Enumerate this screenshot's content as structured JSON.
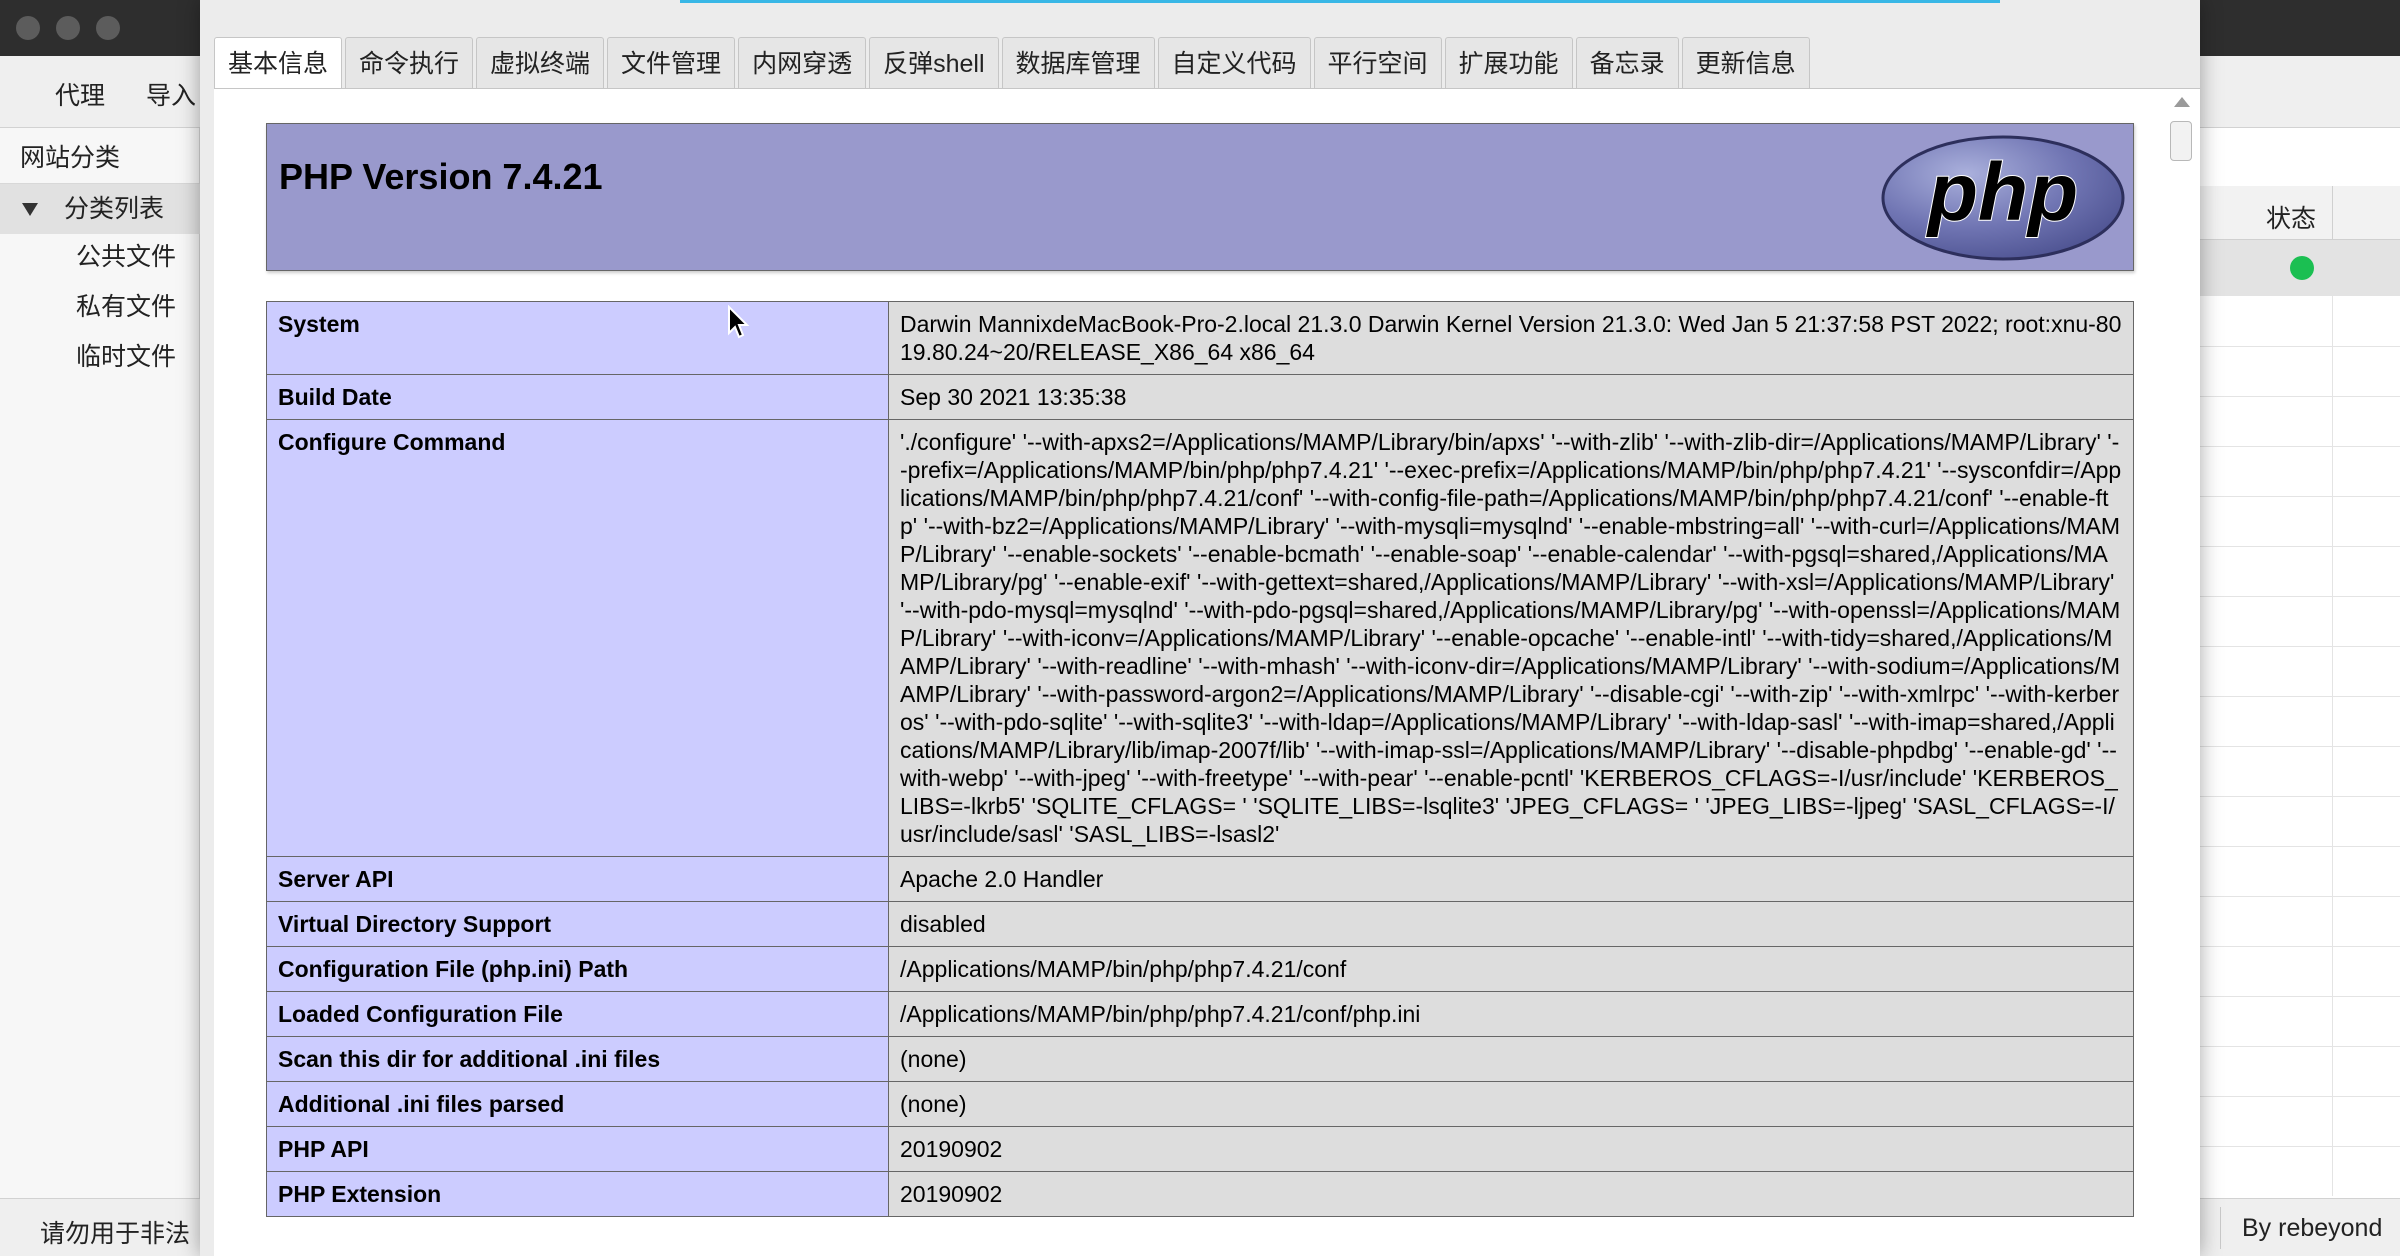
{
  "main_window": {
    "toolbar": {
      "proxy_label": "代理",
      "import_label": "导入"
    },
    "sidebar": {
      "header": "网站分类",
      "tree_root": "分类列表",
      "children": [
        "公共文件",
        "私有文件",
        "临时文件"
      ]
    },
    "table": {
      "status_column": "状态"
    },
    "statusbar": {
      "left_text": "请勿用于非法",
      "right_text": "By rebeyond"
    },
    "colors": {
      "status_online": "#1bbf52"
    }
  },
  "dialog": {
    "tabs": [
      "基本信息",
      "命令执行",
      "虚拟终端",
      "文件管理",
      "内网穿透",
      "反弹shell",
      "数据库管理",
      "自定义代码",
      "平行空间",
      "扩展功能",
      "备忘录",
      "更新信息"
    ],
    "active_tab_index": 0,
    "phpinfo": {
      "title": "PHP Version 7.4.21",
      "logo_text": "php",
      "rows": [
        {
          "key": "System",
          "value": "Darwin MannixdeMacBook-Pro-2.local 21.3.0 Darwin Kernel Version 21.3.0: Wed Jan 5 21:37:58 PST 2022; root:xnu-8019.80.24~20/RELEASE_X86_64 x86_64"
        },
        {
          "key": "Build Date",
          "value": "Sep 30 2021 13:35:38"
        },
        {
          "key": "Configure Command",
          "value": "'./configure' '--with-apxs2=/Applications/MAMP/Library/bin/apxs' '--with-zlib' '--with-zlib-dir=/Applications/MAMP/Library' '--prefix=/Applications/MAMP/bin/php/php7.4.21' '--exec-prefix=/Applications/MAMP/bin/php/php7.4.21' '--sysconfdir=/Applications/MAMP/bin/php/php7.4.21/conf' '--with-config-file-path=/Applications/MAMP/bin/php/php7.4.21/conf' '--enable-ftp' '--with-bz2=/Applications/MAMP/Library' '--with-mysqli=mysqlnd' '--enable-mbstring=all' '--with-curl=/Applications/MAMP/Library' '--enable-sockets' '--enable-bcmath' '--enable-soap' '--enable-calendar' '--with-pgsql=shared,/Applications/MAMP/Library/pg' '--enable-exif' '--with-gettext=shared,/Applications/MAMP/Library' '--with-xsl=/Applications/MAMP/Library' '--with-pdo-mysql=mysqlnd' '--with-pdo-pgsql=shared,/Applications/MAMP/Library/pg' '--with-openssl=/Applications/MAMP/Library' '--with-iconv=/Applications/MAMP/Library' '--enable-opcache' '--enable-intl' '--with-tidy=shared,/Applications/MAMP/Library' '--with-readline' '--with-mhash' '--with-iconv-dir=/Applications/MAMP/Library' '--with-sodium=/Applications/MAMP/Library' '--with-password-argon2=/Applications/MAMP/Library' '--disable-cgi' '--with-zip' '--with-xmlrpc' '--with-kerberos' '--with-pdo-sqlite' '--with-sqlite3' '--with-ldap=/Applications/MAMP/Library' '--with-ldap-sasl' '--with-imap=shared,/Applications/MAMP/Library/lib/imap-2007f/lib' '--with-imap-ssl=/Applications/MAMP/Library' '--disable-phpdbg' '--enable-gd' '--with-webp' '--with-jpeg' '--with-freetype' '--with-pear' '--enable-pcntl' 'KERBEROS_CFLAGS=-I/usr/include' 'KERBEROS_LIBS=-lkrb5' 'SQLITE_CFLAGS= ' 'SQLITE_LIBS=-lsqlite3' 'JPEG_CFLAGS= ' 'JPEG_LIBS=-ljpeg' 'SASL_CFLAGS=-I/usr/include/sasl' 'SASL_LIBS=-lsasl2'"
        },
        {
          "key": "Server API",
          "value": "Apache 2.0 Handler"
        },
        {
          "key": "Virtual Directory Support",
          "value": "disabled"
        },
        {
          "key": "Configuration File (php.ini) Path",
          "value": "/Applications/MAMP/bin/php/php7.4.21/conf"
        },
        {
          "key": "Loaded Configuration File",
          "value": "/Applications/MAMP/bin/php/php7.4.21/conf/php.ini"
        },
        {
          "key": "Scan this dir for additional .ini files",
          "value": "(none)"
        },
        {
          "key": "Additional .ini files parsed",
          "value": "(none)"
        },
        {
          "key": "PHP API",
          "value": "20190902"
        },
        {
          "key": "PHP Extension",
          "value": "20190902"
        }
      ]
    },
    "colors": {
      "header_bg": "#9999cc",
      "key_bg": "#ccccff",
      "value_bg": "#dddddd",
      "progress": "#38b7e6"
    }
  }
}
